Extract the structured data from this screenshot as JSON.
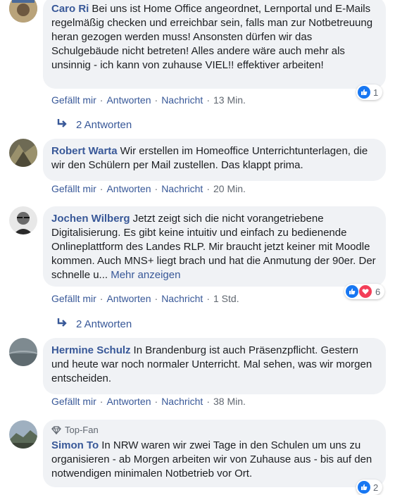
{
  "actions": {
    "like": "Gefällt mir",
    "reply": "Antworten",
    "message": "Nachricht",
    "separator": "·"
  },
  "colors": {
    "link": "#385898",
    "bubble": "#f0f2f5",
    "like": "#1877f2",
    "love": "#f33e58"
  },
  "comments": [
    {
      "author": "Caro Ri",
      "text": "Bei uns ist Home Office angeordnet, Lernportal und E-Mails regelmäßig checken und erreichbar sein, falls man zur Notbetreuung heran gezogen werden muss! Ansonsten dürfen wir das Schulgebäude nicht betreten! Alles andere wäre auch mehr als unsinnig - ich kann von zuhause VIEL!! effektiver arbeiten!",
      "time": "13 Min.",
      "reactions": "1",
      "replies": "2 Antworten"
    },
    {
      "author": "Robert Warta",
      "text": "Wir erstellen im Homeoffice Unterrichtunterlagen, die wir den Schülern per Mail zustellen. Das klappt prima.",
      "time": "20 Min."
    },
    {
      "author": "Jochen Wilberg",
      "text": "Jetzt zeigt sich die nicht vorangetriebene Digitalisierung. Es gibt keine intuitiv und einfach zu bedienende Onlineplattform des Landes RLP. Mir braucht jetzt keiner mit Moodle kommen. Auch MNS+ liegt brach und hat die Anmutung der 90er. Der schnelle u...",
      "more": "Mehr anzeigen",
      "time": "1 Std.",
      "reactions": "6",
      "replies": "2 Antworten"
    },
    {
      "author": "Hermine Schulz",
      "text": "In Brandenburg ist auch Präsenzpflicht. Gestern und heute war noch normaler Unterricht. Mal sehen, was wir morgen entscheiden.",
      "time": "38 Min."
    },
    {
      "badge": "Top-Fan",
      "author": "Simon To",
      "text": "In NRW waren wir zwei Tage in den Schulen um uns zu organisieren - ab Morgen arbeiten wir von Zuhause aus - bis auf den notwendigen minimalen Notbetrieb vor Ort.",
      "reactions": "2"
    }
  ]
}
